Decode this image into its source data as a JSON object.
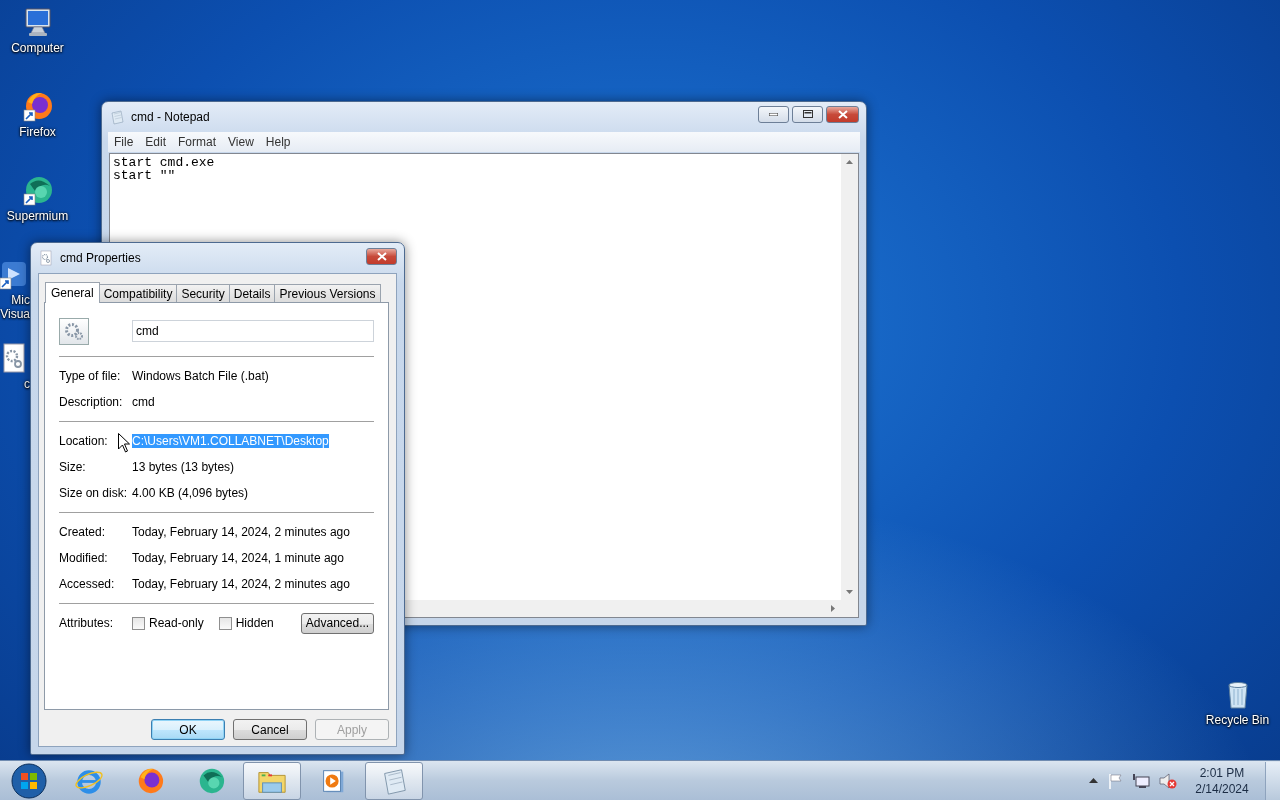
{
  "desktop_icons": [
    {
      "kind": "computer",
      "label": "Computer"
    },
    {
      "kind": "firefox",
      "label": "Firefox"
    },
    {
      "kind": "supermium",
      "label": "Supermium"
    },
    {
      "kind": "app",
      "label": "Mic Visua"
    },
    {
      "kind": "batch",
      "label": "c"
    }
  ],
  "recycle_bin": {
    "label": "Recycle Bin"
  },
  "notepad": {
    "title": "cmd - Notepad",
    "menu": [
      "File",
      "Edit",
      "Format",
      "View",
      "Help"
    ],
    "lines": [
      "start cmd.exe",
      "start \"\""
    ]
  },
  "properties": {
    "title": "cmd Properties",
    "tabs": [
      {
        "label": "General",
        "selected": true
      },
      {
        "label": "Compatibility",
        "selected": false
      },
      {
        "label": "Security",
        "selected": false
      },
      {
        "label": "Details",
        "selected": false
      },
      {
        "label": "Previous Versions",
        "selected": false
      }
    ],
    "file_name": "cmd",
    "sections": [
      [
        {
          "label": "Type of file:",
          "value": "Windows Batch File (.bat)",
          "selected": false
        },
        {
          "label": "Description:",
          "value": "cmd",
          "selected": false
        }
      ],
      [
        {
          "label": "Location:",
          "value": "C:\\Users\\VM1.COLLABNET\\Desktop",
          "selected": true
        },
        {
          "label": "Size:",
          "value": "13 bytes (13 bytes)",
          "selected": false
        },
        {
          "label": "Size on disk:",
          "value": "4.00 KB (4,096 bytes)",
          "selected": false
        }
      ],
      [
        {
          "label": "Created:",
          "value": "Today, February 14, 2024, 2 minutes ago",
          "selected": false
        },
        {
          "label": "Modified:",
          "value": "Today, February 14, 2024, 1 minute ago",
          "selected": false
        },
        {
          "label": "Accessed:",
          "value": "Today, February 14, 2024, 2 minutes ago",
          "selected": false
        }
      ]
    ],
    "attributes": {
      "label": "Attributes:",
      "options": [
        {
          "label": "Read-only",
          "checked": false
        },
        {
          "label": "Hidden",
          "checked": false
        }
      ],
      "advanced": "Advanced..."
    },
    "buttons": [
      {
        "label": "OK",
        "default": true,
        "disabled": false
      },
      {
        "label": "Cancel",
        "default": false,
        "disabled": false
      },
      {
        "label": "Apply",
        "default": false,
        "disabled": true
      }
    ]
  },
  "taskbar": {
    "apps": [
      {
        "kind": "ie",
        "running": false
      },
      {
        "kind": "firefox",
        "running": false
      },
      {
        "kind": "supermium",
        "running": false
      },
      {
        "kind": "explorer",
        "running": true
      },
      {
        "kind": "media",
        "running": false
      },
      {
        "kind": "notepad",
        "running": true
      }
    ],
    "time": "2:01 PM",
    "date": "2/14/2024"
  }
}
